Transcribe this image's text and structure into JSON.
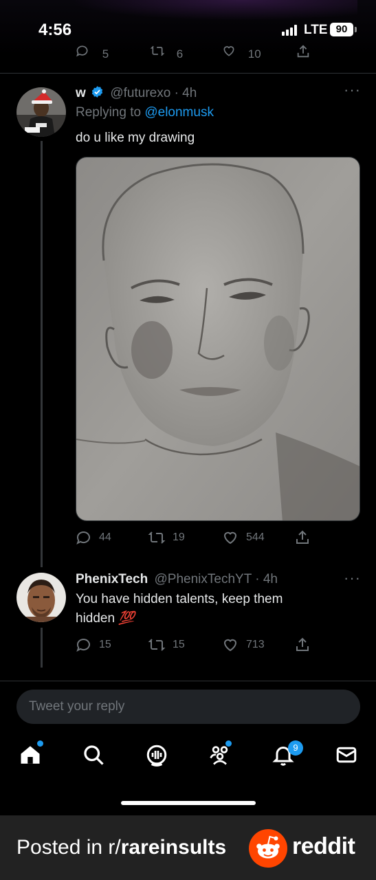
{
  "status_bar": {
    "time": "4:56",
    "network": "LTE",
    "battery": "90"
  },
  "previous_tweet_actions": {
    "replies": "5",
    "retweets": "6",
    "likes": "10"
  },
  "tweet": {
    "display_name": "w",
    "handle": "@futurexo",
    "time": "· 4h",
    "reply_prefix": "Replying to",
    "reply_mention": "@elonmusk",
    "text": "do u like my drawing",
    "replies": "44",
    "retweets": "19",
    "likes": "544"
  },
  "reply": {
    "display_name": "PhenixTech",
    "handle": "@PhenixTechYT",
    "time": "· 4h",
    "text_line1": "You have hidden talents, keep them",
    "text_line2": "hidden",
    "emoji": "💯",
    "replies": "15",
    "retweets": "15",
    "likes": "713"
  },
  "compose": {
    "placeholder": "Tweet your reply"
  },
  "tab_bar": {
    "items": [
      "home-icon",
      "search-icon",
      "spaces-icon",
      "communities-icon",
      "notifications-icon",
      "messages-icon"
    ],
    "notification_count": "9"
  },
  "watermark": {
    "prefix": "Posted in r/",
    "subreddit": "rareinsults",
    "brand": "reddit"
  },
  "colors": {
    "accent": "#1d9bf0",
    "muted": "#71767b",
    "text": "#e7e9ea",
    "reddit": "#ff4500"
  }
}
